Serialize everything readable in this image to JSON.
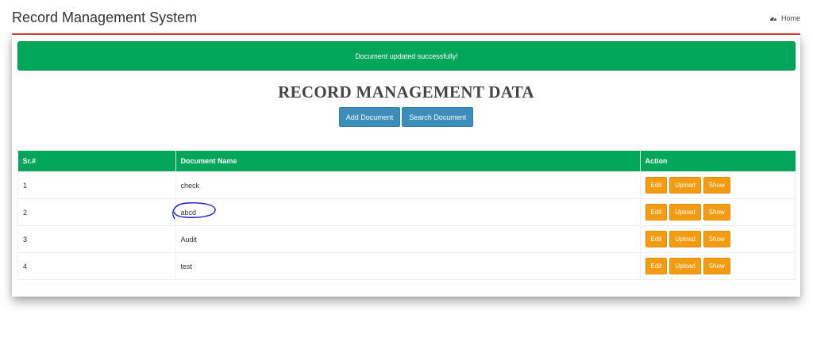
{
  "header": {
    "title": "Record Management System",
    "home_label": "Home"
  },
  "alert": {
    "message": "Document updated successfully!"
  },
  "main": {
    "heading": "RECORD MANAGEMENT DATA",
    "add_button": "Add Document",
    "search_button": "Search Document"
  },
  "table": {
    "columns": [
      "Sr.#",
      "Document Name",
      "Action"
    ],
    "rows": [
      {
        "sr": "1",
        "name": "check"
      },
      {
        "sr": "2",
        "name": "abcd"
      },
      {
        "sr": "3",
        "name": "Audit"
      },
      {
        "sr": "4",
        "name": "test"
      }
    ],
    "actions": {
      "edit": "Edit",
      "upload": "Upload",
      "show": "Show"
    }
  },
  "colors": {
    "accent_red": "#dd4b39",
    "success_green": "#00a65a",
    "primary_blue": "#3c8dbc",
    "warning_orange": "#f39c12",
    "annotation_blue": "#1a1adb"
  },
  "icons": {
    "home": "dashboard-icon"
  }
}
